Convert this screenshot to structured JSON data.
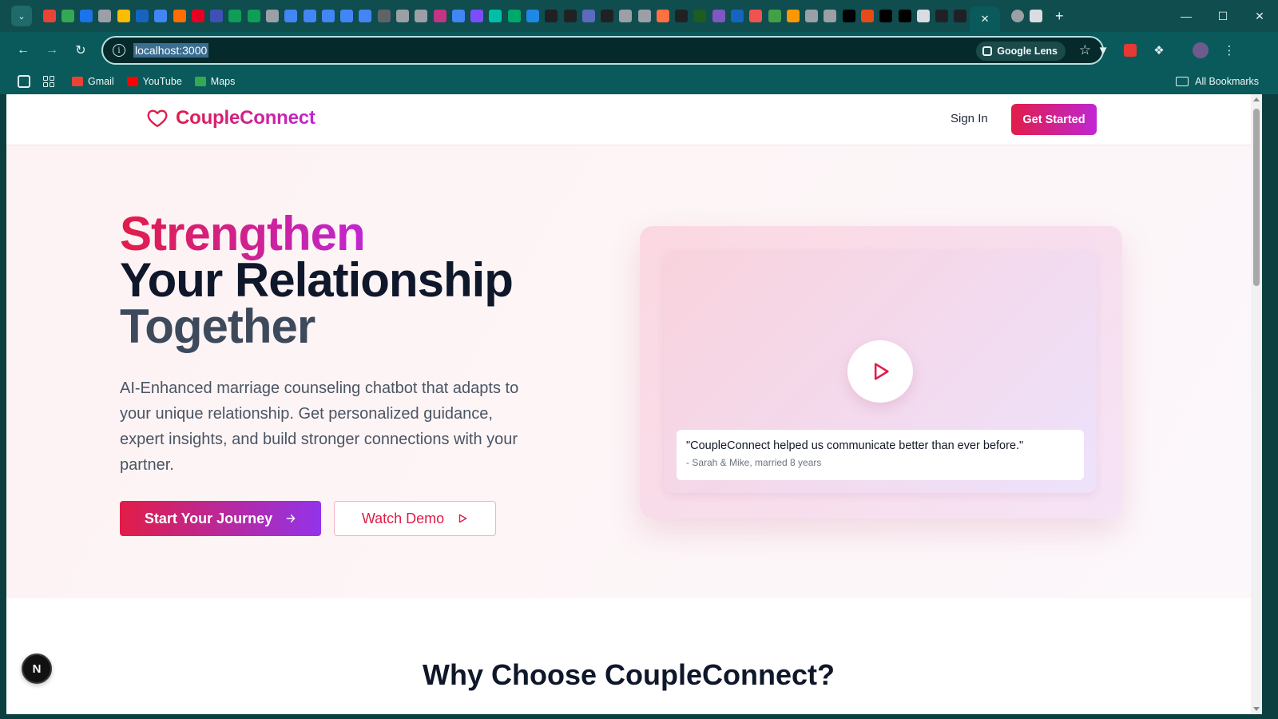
{
  "browser": {
    "tab_favicons": [
      "#ea4335",
      "#34a853",
      "#1a73e8",
      "#9aa0a6",
      "#fbbc04",
      "#1565c0",
      "#4285f4",
      "#ff6d00",
      "#e60023",
      "#3f51b5",
      "#0f9d58",
      "#0f9d58",
      "#9aa0a6",
      "#4285f4",
      "#4285f4",
      "#4285f4",
      "#4285f4",
      "#4285f4",
      "#5f6368",
      "#9aa0a6",
      "#9aa0a6",
      "#c13584",
      "#4285f4",
      "#7c4dff",
      "#00bfa5",
      "#00a86b",
      "#1e88e5",
      "#202124",
      "#202124",
      "#5c6bc0",
      "#202124",
      "#9aa0a6",
      "#9aa0a6",
      "#ff7043",
      "#202124",
      "#1b5e20",
      "#7e57c2",
      "#1565c0",
      "#ef5350",
      "#43a047",
      "#ff9800",
      "#9aa0a6",
      "#9aa0a6",
      "#000000",
      "#e64a19",
      "#000000",
      "#000000",
      "#dadce0",
      "#202124",
      "#202124"
    ],
    "url": "localhost:3000",
    "lens_label": "Google Lens",
    "bookmarks": [
      {
        "label": "Gmail",
        "color": "#ea4335"
      },
      {
        "label": "YouTube",
        "color": "#ff0000"
      },
      {
        "label": "Maps",
        "color": "#34a853"
      }
    ],
    "all_bookmarks_label": "All Bookmarks",
    "icons": {
      "tab_search": "chevron-down-icon",
      "back": "arrow-left-icon",
      "forward": "arrow-right-icon",
      "reload": "reload-icon",
      "site_info": "info-icon",
      "star": "star-icon",
      "close_tab": "close-icon",
      "new_tab": "plus-icon"
    }
  },
  "site": {
    "brand": "CoupleConnect",
    "nav": {
      "sign_in": "Sign In",
      "get_started": "Get Started"
    },
    "hero": {
      "title_line1": "Strengthen",
      "title_line2": "Your Relationship",
      "title_line3": "Together",
      "description": "AI-Enhanced marriage counseling chatbot that adapts to your unique relationship. Get personalized guidance, expert insights, and build stronger connections with your partner.",
      "cta_primary": "Start Your Journey",
      "cta_secondary": "Watch Demo"
    },
    "testimonial": {
      "quote": "\"CoupleConnect helped us communicate better than ever before.\"",
      "author": "- Sarah & Mike, married 8 years"
    },
    "why_section_title": "Why Choose CoupleConnect?",
    "dev_badge": "N",
    "colors": {
      "brand_pink": "#e11d48",
      "brand_purple": "#c026d3",
      "heading_dark": "#0f172a"
    }
  }
}
